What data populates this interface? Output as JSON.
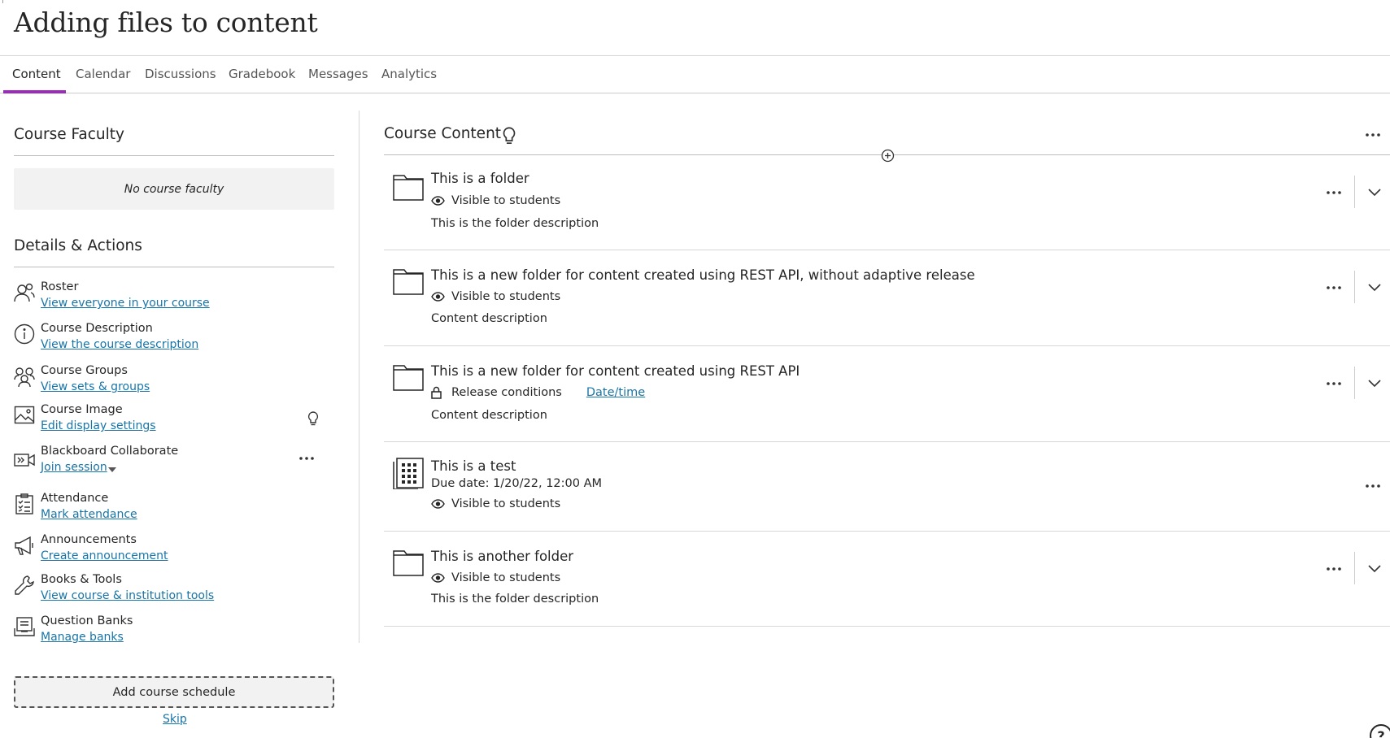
{
  "page": {
    "title": "Adding files to content"
  },
  "tabs": [
    {
      "label": "Content"
    },
    {
      "label": "Calendar"
    },
    {
      "label": "Discussions"
    },
    {
      "label": "Gradebook"
    },
    {
      "label": "Messages"
    },
    {
      "label": "Analytics"
    }
  ],
  "left": {
    "faculty_heading": "Course Faculty",
    "no_faculty": "No course faculty",
    "details_heading": "Details & Actions",
    "actions": [
      {
        "label": "Roster",
        "link": "View everyone in your course",
        "icon": "roster-icon"
      },
      {
        "label": "Course Description",
        "link": "View the course description",
        "icon": "info-icon"
      },
      {
        "label": "Course Groups",
        "link": "View sets & groups",
        "icon": "groups-icon"
      },
      {
        "label": "Course Image",
        "link": "Edit display settings",
        "icon": "image-icon"
      },
      {
        "label": "Blackboard Collaborate",
        "link": "Join session",
        "icon": "video-icon"
      },
      {
        "label": "Attendance",
        "link": "Mark attendance",
        "icon": "attendance-icon"
      },
      {
        "label": "Announcements",
        "link": "Create announcement",
        "icon": "megaphone-icon"
      },
      {
        "label": "Books & Tools",
        "link": "View course & institution tools",
        "icon": "wrench-icon"
      },
      {
        "label": "Question Banks",
        "link": "Manage banks",
        "icon": "question-bank-icon"
      }
    ],
    "schedule_button": "Add course schedule",
    "skip": "Skip"
  },
  "content": {
    "heading": "Course Content",
    "items": [
      {
        "title": "This is a folder",
        "status": "Visible to students",
        "description": "This is the folder description",
        "icon": "folder-icon"
      },
      {
        "title": "This is a new folder for content created using REST API, without adaptive release",
        "status": "Visible to students",
        "description": "Content description",
        "icon": "folder-icon"
      },
      {
        "title": "This is a new folder for content created using REST API",
        "status": "Release conditions",
        "release_link": "Date/time",
        "description": "Content description",
        "icon": "folder-icon"
      },
      {
        "title": "This is a test",
        "due": "Due date: 1/20/22, 12:00 AM",
        "status": "Visible to students",
        "icon": "test-icon"
      },
      {
        "title": "This is another folder",
        "status": "Visible to students",
        "description": "This is the folder description",
        "icon": "folder-icon"
      }
    ]
  },
  "help": "?"
}
